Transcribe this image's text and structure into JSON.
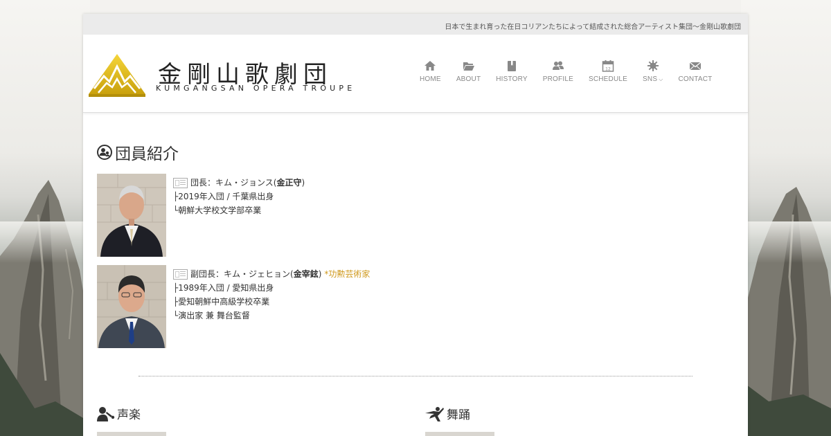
{
  "tagline": "日本で生まれ育った在日コリアンたちによって結成された総合アーティスト集団～金剛山歌劇団",
  "logo": {
    "title": "金剛山歌劇団",
    "subtitle": "KUMGANGSAN OPERA TROUPE"
  },
  "nav": [
    {
      "label": "HOME",
      "icon": "home-icon"
    },
    {
      "label": "ABOUT",
      "icon": "folder-icon"
    },
    {
      "label": "HISTORY",
      "icon": "book-icon"
    },
    {
      "label": "PROFILE",
      "icon": "people-icon"
    },
    {
      "label": "SCHEDULE",
      "icon": "calendar-icon"
    },
    {
      "label": "SNS",
      "icon": "gear-icon"
    },
    {
      "label": "CONTACT",
      "icon": "mail-icon"
    }
  ],
  "calendar_day": "12",
  "section_title": "団員紹介",
  "members": [
    {
      "role": "団長：キム・ジョンス(",
      "name": "金正守",
      "close": ")",
      "honor": "",
      "lines": [
        "├2019年入団 / 千葉県出身",
        "└朝鮮大学校文学部卒業"
      ]
    },
    {
      "role": "副団長：キム・ジェヒョン(",
      "name": "金宰鉉",
      "close": ")",
      "honor": "*功勲芸術家",
      "lines": [
        "├1989年入団 / 愛知県出身",
        "├愛知朝鮮中高級学校卒業",
        "└演出家 兼 舞台監督"
      ]
    }
  ],
  "subsections": [
    {
      "title": "声楽",
      "icon": "singer-icon"
    },
    {
      "title": "舞踊",
      "icon": "dancer-icon"
    }
  ],
  "colors": {
    "accent_gold": "#d09a1e",
    "logo_gold": "#e8c21a",
    "nav_gray": "#888888"
  }
}
